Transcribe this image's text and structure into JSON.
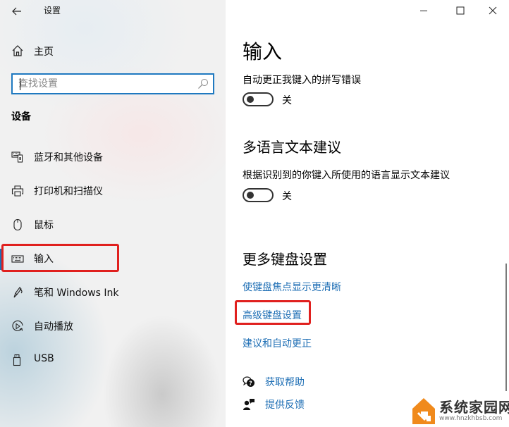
{
  "window": {
    "title": "设置",
    "controls": {
      "minimize_icon": "minimize-icon",
      "maximize_icon": "maximize-icon",
      "close_icon": "close-icon"
    }
  },
  "sidebar": {
    "back_icon": "arrow-left-icon",
    "home": {
      "label": "主页",
      "icon": "home-icon"
    },
    "search": {
      "placeholder": "查找设置",
      "value": "",
      "icon": "search-icon"
    },
    "section_title": "设备",
    "items": [
      {
        "label": "蓝牙和其他设备",
        "icon": "bluetooth-devices-icon",
        "active": false
      },
      {
        "label": "打印机和扫描仪",
        "icon": "printer-icon",
        "active": false
      },
      {
        "label": "鼠标",
        "icon": "mouse-icon",
        "active": false
      },
      {
        "label": "输入",
        "icon": "keyboard-icon",
        "active": true
      },
      {
        "label": "笔和 Windows Ink",
        "icon": "pen-icon",
        "active": false
      },
      {
        "label": "自动播放",
        "icon": "autoplay-icon",
        "active": false
      },
      {
        "label": "USB",
        "icon": "usb-icon",
        "active": false
      }
    ]
  },
  "main": {
    "page_title": "输入",
    "settings": [
      {
        "description": "自动更正我键入的拼写错误",
        "toggle_on": false,
        "state_label": "关"
      }
    ],
    "multilingual": {
      "heading": "多语言文本建议",
      "description": "根据识别到的你键入所使用的语言显示文本建议",
      "toggle_on": false,
      "state_label": "关"
    },
    "more_keyboard": {
      "heading": "更多键盘设置",
      "links": [
        "使键盘焦点显示更清晰",
        "高级键盘设置",
        "建议和自动更正"
      ]
    },
    "help": [
      {
        "label": "获取帮助",
        "icon": "help-chat-icon"
      },
      {
        "label": "提供反馈",
        "icon": "feedback-icon"
      }
    ]
  },
  "annotations": {
    "highlight_color": "#e0201e",
    "highlighted": [
      "sidebar-item-input",
      "advanced-keyboard-settings-link"
    ]
  },
  "watermark": {
    "title": "系统家园网",
    "url": "www.hnzkhbsb.com",
    "brand_color": "#f08a1c"
  },
  "colors": {
    "accent": "#1f6fb5",
    "search_border": "#1f79c0",
    "toggle_off": "#333333"
  }
}
